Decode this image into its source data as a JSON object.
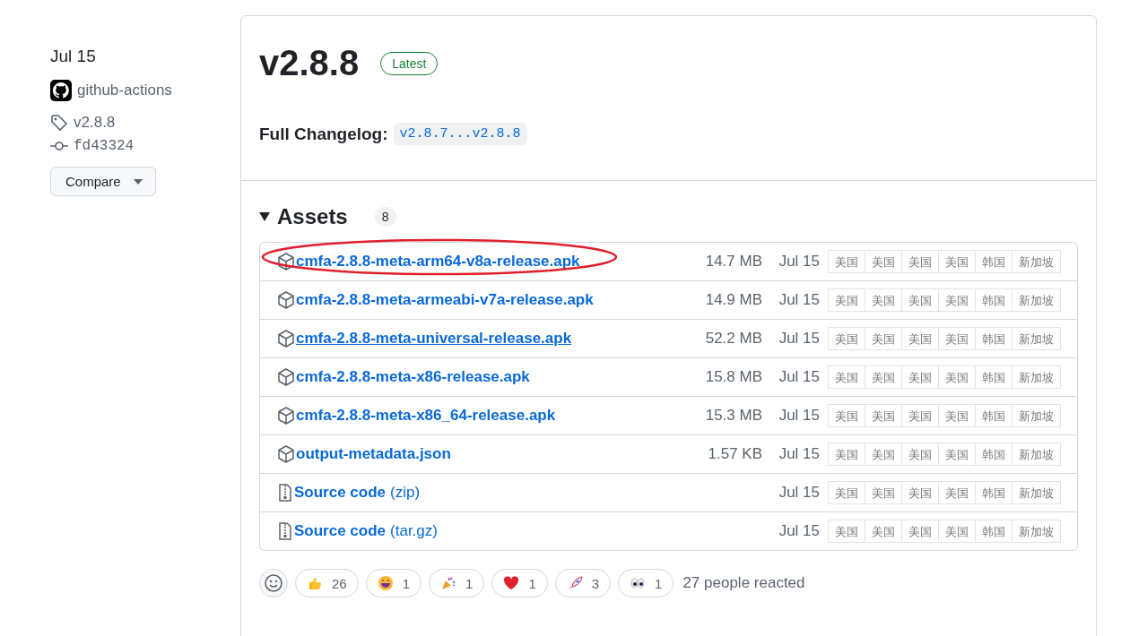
{
  "sidebar": {
    "date": "Jul 15",
    "author": "github-actions",
    "tag": "v2.8.8",
    "commit": "fd43324",
    "compare_button": "Compare"
  },
  "release": {
    "title": "v2.8.8",
    "badge": "Latest",
    "changelog_label": "Full Changelog:",
    "changelog_link": "v2.8.7...v2.8.8"
  },
  "assets": {
    "title": "Assets",
    "count": "8",
    "rows": [
      {
        "kind": "package",
        "name": "cmfa-2.8.8-meta-arm64-v8a-release.apk",
        "size": "14.7 MB",
        "date": "Jul 15",
        "circled": true,
        "hovered": false,
        "mirrors": [
          "美国",
          "美国",
          "美国",
          "美国",
          "韩国",
          "新加坡"
        ]
      },
      {
        "kind": "package",
        "name": "cmfa-2.8.8-meta-armeabi-v7a-release.apk",
        "size": "14.9 MB",
        "date": "Jul 15",
        "circled": false,
        "hovered": false,
        "mirrors": [
          "美国",
          "美国",
          "美国",
          "美国",
          "韩国",
          "新加坡"
        ]
      },
      {
        "kind": "package",
        "name": "cmfa-2.8.8-meta-universal-release.apk",
        "size": "52.2 MB",
        "date": "Jul 15",
        "circled": false,
        "hovered": true,
        "mirrors": [
          "美国",
          "美国",
          "美国",
          "美国",
          "韩国",
          "新加坡"
        ]
      },
      {
        "kind": "package",
        "name": "cmfa-2.8.8-meta-x86-release.apk",
        "size": "15.8 MB",
        "date": "Jul 15",
        "circled": false,
        "hovered": false,
        "mirrors": [
          "美国",
          "美国",
          "美国",
          "美国",
          "韩国",
          "新加坡"
        ]
      },
      {
        "kind": "package",
        "name": "cmfa-2.8.8-meta-x86_64-release.apk",
        "size": "15.3 MB",
        "date": "Jul 15",
        "circled": false,
        "hovered": false,
        "mirrors": [
          "美国",
          "美国",
          "美国",
          "美国",
          "韩国",
          "新加坡"
        ]
      },
      {
        "kind": "package",
        "name": "output-metadata.json",
        "size": "1.57 KB",
        "date": "Jul 15",
        "circled": false,
        "hovered": false,
        "mirrors": [
          "美国",
          "美国",
          "美国",
          "美国",
          "韩国",
          "新加坡"
        ]
      },
      {
        "kind": "archive",
        "name": "Source code",
        "suffix": "(zip)",
        "date": "Jul 15",
        "circled": false,
        "hovered": false,
        "mirrors": [
          "美国",
          "美国",
          "美国",
          "美国",
          "韩国",
          "新加坡"
        ]
      },
      {
        "kind": "archive",
        "name": "Source code",
        "suffix": "(tar.gz)",
        "date": "Jul 15",
        "circled": false,
        "hovered": false,
        "mirrors": [
          "美国",
          "美国",
          "美国",
          "美国",
          "韩国",
          "新加坡"
        ]
      }
    ]
  },
  "reactions": {
    "items": [
      {
        "kind": "thumbs",
        "count": "26"
      },
      {
        "kind": "laugh",
        "count": "1"
      },
      {
        "kind": "hooray",
        "count": "1"
      },
      {
        "kind": "heart",
        "count": "1"
      },
      {
        "kind": "rocket",
        "count": "3"
      },
      {
        "kind": "eyes",
        "count": "1"
      }
    ],
    "summary": "27 people reacted"
  }
}
